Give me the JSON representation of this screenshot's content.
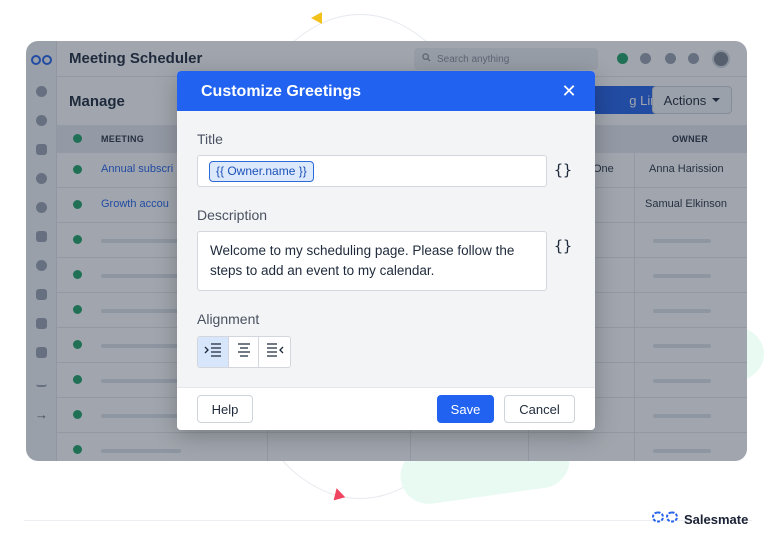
{
  "app": {
    "title": "Meeting Scheduler",
    "search_placeholder": "Search anything",
    "page_title": "Manage",
    "primary_button_label": "g Link",
    "actions_label": "Actions"
  },
  "table": {
    "headers": {
      "meeting": "MEETING",
      "owner": "OWNER"
    },
    "rows": [
      {
        "meeting": "Annual subscri",
        "status": "One",
        "owner": "Anna Harission"
      },
      {
        "meeting": "Growth accou",
        "status": "",
        "owner": "Samual Elkinson"
      }
    ]
  },
  "modal": {
    "title": "Customize Greetings",
    "title_label": "Title",
    "title_token": "{{ Owner.name }}",
    "placeholder_button": "{}",
    "description_label": "Description",
    "description_value": "Welcome to my scheduling page. Please follow the steps to add an event to my calendar.",
    "alignment_label": "Alignment",
    "alignment_options": [
      "left",
      "center",
      "right"
    ],
    "alignment_selected": "left",
    "help_label": "Help",
    "save_label": "Save",
    "cancel_label": "Cancel"
  },
  "brand": {
    "name": "Salesmate"
  },
  "colors": {
    "primary": "#2163f0",
    "status_green": "#21a366",
    "accent_yellow": "#f2c21b",
    "accent_red": "#ef4560"
  },
  "icons": {
    "close": "close-icon",
    "search": "search-icon",
    "align_left": "align-left-icon",
    "align_center": "align-center-icon",
    "align_right": "align-right-icon"
  }
}
